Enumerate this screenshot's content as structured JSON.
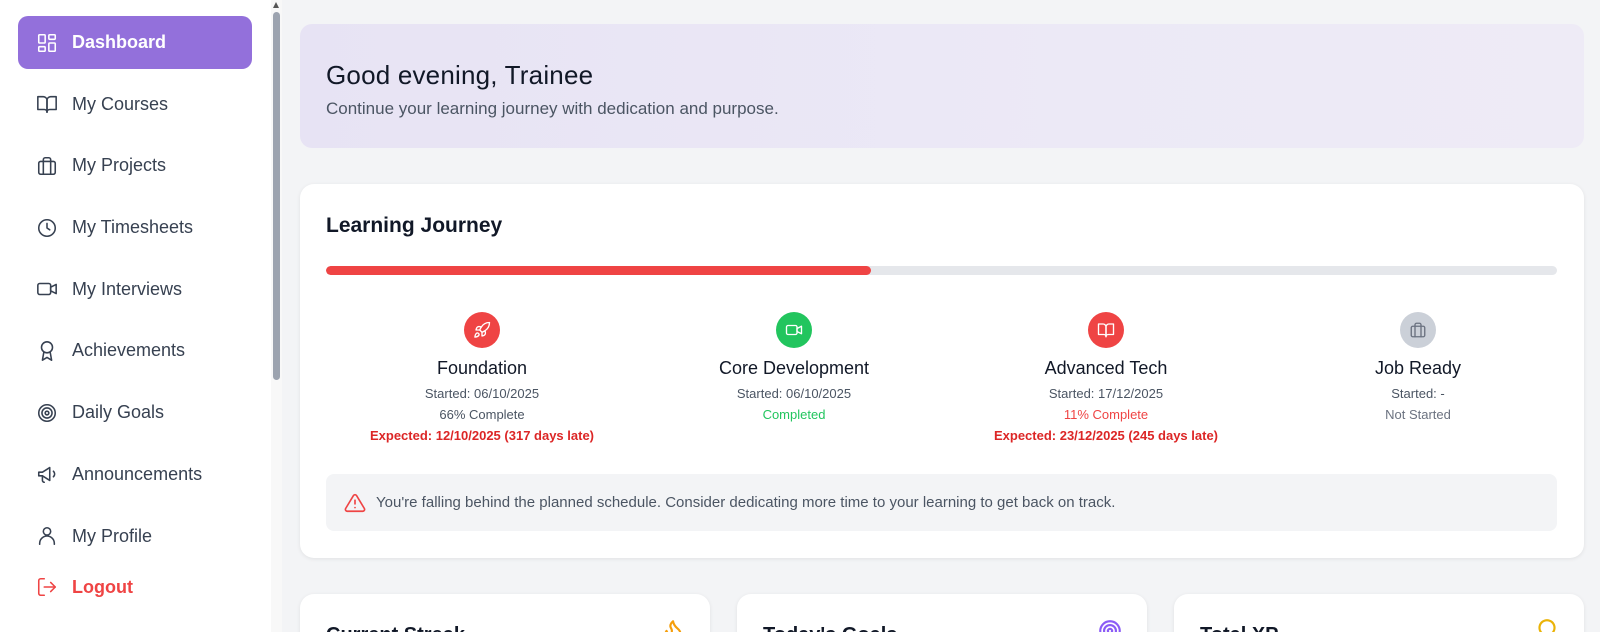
{
  "sidebar": {
    "items": [
      {
        "label": "Dashboard",
        "icon": "dashboard-icon",
        "active": true
      },
      {
        "label": "My Courses",
        "icon": "book-icon"
      },
      {
        "label": "My Projects",
        "icon": "briefcase-icon"
      },
      {
        "label": "My Timesheets",
        "icon": "clock-icon"
      },
      {
        "label": "My Interviews",
        "icon": "video-icon"
      },
      {
        "label": "Achievements",
        "icon": "award-icon"
      },
      {
        "label": "Daily Goals",
        "icon": "target-icon"
      },
      {
        "label": "Announcements",
        "icon": "megaphone-icon"
      },
      {
        "label": "My Profile",
        "icon": "user-icon"
      }
    ],
    "logout_label": "Logout"
  },
  "greeting": {
    "title": "Good evening, Trainee",
    "subtitle": "Continue your learning journey with dedication and purpose."
  },
  "journey": {
    "title": "Learning Journey",
    "progress_percent": 44.3,
    "stages": [
      {
        "name": "Foundation",
        "started": "Started: 06/10/2025",
        "status": "66% Complete",
        "status_color": "#4b5563",
        "expected": "Expected: 12/10/2025 (317 days late)",
        "icon": "rocket-icon",
        "icon_bg": "#ef4444"
      },
      {
        "name": "Core Development",
        "started": "Started: 06/10/2025",
        "status": "Completed",
        "status_color": "#22c55e",
        "expected": "",
        "icon": "video-icon",
        "icon_bg": "#22c55e"
      },
      {
        "name": "Advanced Tech",
        "started": "Started: 17/12/2025",
        "status": "11% Complete",
        "status_color": "#ef4444",
        "expected": "Expected: 23/12/2025 (245 days late)",
        "icon": "book-icon",
        "icon_bg": "#ef4444"
      },
      {
        "name": "Job Ready",
        "started": "Started: -",
        "status": "Not Started",
        "status_color": "#6b7280",
        "expected": "",
        "icon": "briefcase-icon",
        "icon_bg": "#cbd0d8"
      }
    ],
    "warning": "You're falling behind the planned schedule. Consider dedicating more time to your learning to get back on track."
  },
  "stats": [
    {
      "title": "Current Streak",
      "icon": "flame-icon",
      "color": "#f59e0b"
    },
    {
      "title": "Today's Goals",
      "icon": "target-icon",
      "color": "#8b5cf6"
    },
    {
      "title": "Total XP",
      "icon": "bulb-icon",
      "color": "#eab308"
    }
  ],
  "colors": {
    "accent": "#9370db",
    "danger": "#ef4444",
    "success": "#22c55e"
  }
}
